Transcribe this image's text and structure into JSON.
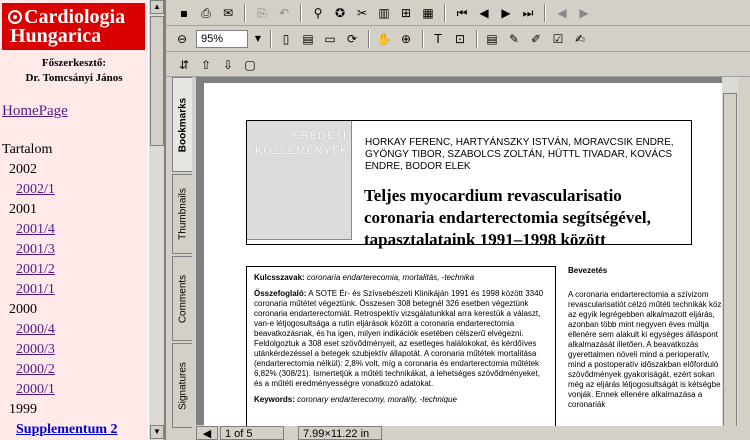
{
  "site": {
    "logo_line1": "Cardiologia",
    "logo_line2": "Hungarica",
    "editor_label": "Főszerkesztő:",
    "editor_name": "Dr. Tomcsányi János",
    "home_link": "HomePage",
    "toc_label": "Tartalom",
    "toc": [
      {
        "year": "2002",
        "issues": [
          "2002/1"
        ]
      },
      {
        "year": "2001",
        "issues": [
          "2001/4",
          "2001/3",
          "2001/2",
          "2001/1"
        ]
      },
      {
        "year": "2000",
        "issues": [
          "2000/4",
          "2000/3",
          "2000/2",
          "2000/1"
        ]
      },
      {
        "year": "1999",
        "issues": []
      }
    ],
    "supplement": "Supplementum 2"
  },
  "viewer": {
    "zoom": "95%",
    "page_status": "1 of 5",
    "page_size": "7.99×11.22 in",
    "tabs": [
      "Bookmarks",
      "Thumbnails",
      "Comments",
      "Signatures"
    ],
    "active_tab": "Bookmarks"
  },
  "article": {
    "badge_line1": "EREDETI",
    "badge_line2": "KÖZLEMÉNYEK",
    "authors": "HORKAY FERENC, HARTYÁNSZKY ISTVÁN, MORAVCSIK ENDRE, GYÖNGY TIBOR, SZABOLCS ZOLTÁN, HÜTTL TIVADAR, KOVÁCS ENDRE, BODOR ELEK",
    "title": "Teljes myocardium revascularisatio coronaria endarterectomia segítségével, tapasztalataink 1991–1998 között",
    "keywords_hu_label": "Kulcsszavak:",
    "keywords_hu": "coronaria endarterecomia, mortalitás, -technika",
    "summary_label": "Összefoglaló:",
    "summary": "A SOTE Ér- és Szívsebészeti Klinikáján 1991 és 1998 között 3340 coronaria műtétet végeztünk. Összesen 308 betegnél 326 esetben végeztünk coronaria endarterectomiát. Retrospektív vizsgálatunkkal arra kerestük a választ, van-e létjogosultsága a rutin eljárások között a coronaria endarterectomia beavatkozásnak, és ha igen, milyen indikációk esetében célszerű elvégezni. Feldolgoztuk a 308 eset szövődményeit, az esetleges halálokokat, és kérdőíves utánkérdezéssel a betegek szubjektív állapotát. A coronaria műtétek mortalitása (endarterectomia nélkül): 2,8% volt, míg a coronaria és endarterectomia műtétek 6,82% (308/21). Ismertetjük a műtéti technikákat, a lehetséges szövődményeket, és a műtéti eredményességre vonatkozó adatokat.",
    "keywords_en_label": "Keywords:",
    "keywords_en": "coronary endarterecomy, morality, -technique",
    "intro_heading": "Bevezetés",
    "intro_text": "A coronaria endarterectomia a szívizom revascularisatiót célzó műtéti technikák közül az egyik legrégebben alkalmazott eljárás, azonban több mint negyven éves múltja ellenére sem alakult ki egységes álláspont alkalmazását illetően. A beavatkozás gyerettalmen növeli mind a perioperatív, mind a postoperatív időszakban előforduló szövődmények gyakoriságát, ezért sokan még az eljárás létjogosultságát is kétségbe vonják. Ennek ellenére alkalmazása a coronariák"
  }
}
